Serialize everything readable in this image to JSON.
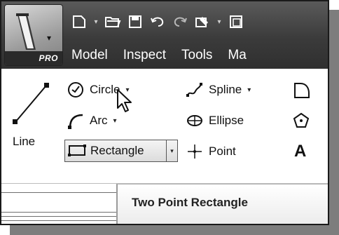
{
  "app": {
    "edition_label": "PRO"
  },
  "quick_access": [
    {
      "name": "new-document-icon"
    },
    {
      "name": "open-folder-icon"
    },
    {
      "name": "save-icon"
    },
    {
      "name": "undo-icon"
    },
    {
      "name": "redo-icon"
    },
    {
      "name": "wrench-icon"
    },
    {
      "name": "screenshot-icon"
    }
  ],
  "tabs": [
    "Model",
    "Inspect",
    "Tools",
    "Ma"
  ],
  "ribbon": {
    "line_label": "Line",
    "circle_label": "Circle",
    "arc_label": "Arc",
    "rectangle_label": "Rectangle",
    "spline_label": "Spline",
    "ellipse_label": "Ellipse",
    "point_label": "Point",
    "text_label": "A"
  },
  "tooltip": {
    "text": "Two Point Rectangle"
  },
  "colors": {
    "topbar": "#3b3b3b",
    "ribbon_bg": "#ffffff",
    "tooltip_bg": "#ececec"
  }
}
